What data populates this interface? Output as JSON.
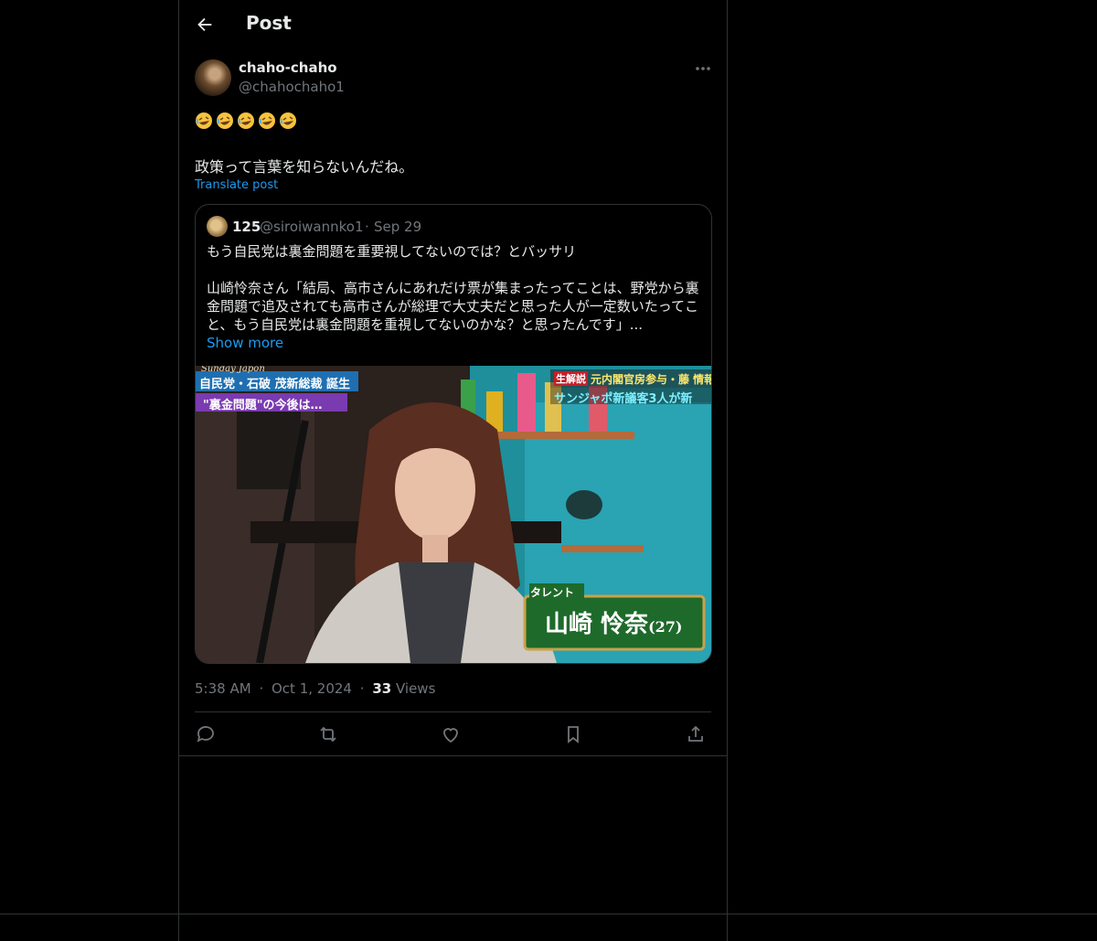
{
  "header": {
    "title": "Post"
  },
  "author": {
    "display_name": "chaho-chaho",
    "handle": "@chahochaho1"
  },
  "post": {
    "emojis": [
      "rolling-on-floor-laughing",
      "rolling-on-floor-laughing",
      "rolling-on-floor-laughing",
      "rolling-on-floor-laughing",
      "rolling-on-floor-laughing"
    ],
    "text": "政策って言葉を知らないんだね。",
    "translate_label": "Translate post"
  },
  "quote": {
    "name": "125",
    "handle": "@siroiwannko1",
    "separator": "·",
    "date": "Sep 29",
    "line1": "もう自民党は裏金問題を重要視してないのでは？とバッサリ",
    "line2": "山崎怜奈さん「結局、高市さんにあれだけ票が集まったってことは、野党から裏",
    "line3": "金問題で追及されても高市さんが総理で大丈夫だと思った人が一定数いたってこ",
    "line4": "と、もう自民党は裏金問題を重視してないのかな？と思ったんです」...",
    "show_more": "Show more",
    "media": {
      "caption_left1": "自民党・石破 茂新総裁 誕生",
      "caption_left2": "\"裏金問題\"の今後は…",
      "caption_right1": "元内閣官房参与・藤 情報",
      "caption_right2": "サンジャポ新議客3人が新",
      "tag_top_left": "Sunday Japon",
      "tag_small": "生解説",
      "nameplate_role": "タレント",
      "nameplate_name": "山崎 怜奈",
      "nameplate_age": "(27)"
    }
  },
  "meta": {
    "time": "5:38 AM",
    "dot": "·",
    "date": "Oct 1, 2024",
    "views_count": "33",
    "views_label": "Views"
  },
  "colors": {
    "background": "#000000",
    "text": "#e7e9ea",
    "muted": "#71767b",
    "accent": "#1d9bf0",
    "border": "#2f3336"
  }
}
